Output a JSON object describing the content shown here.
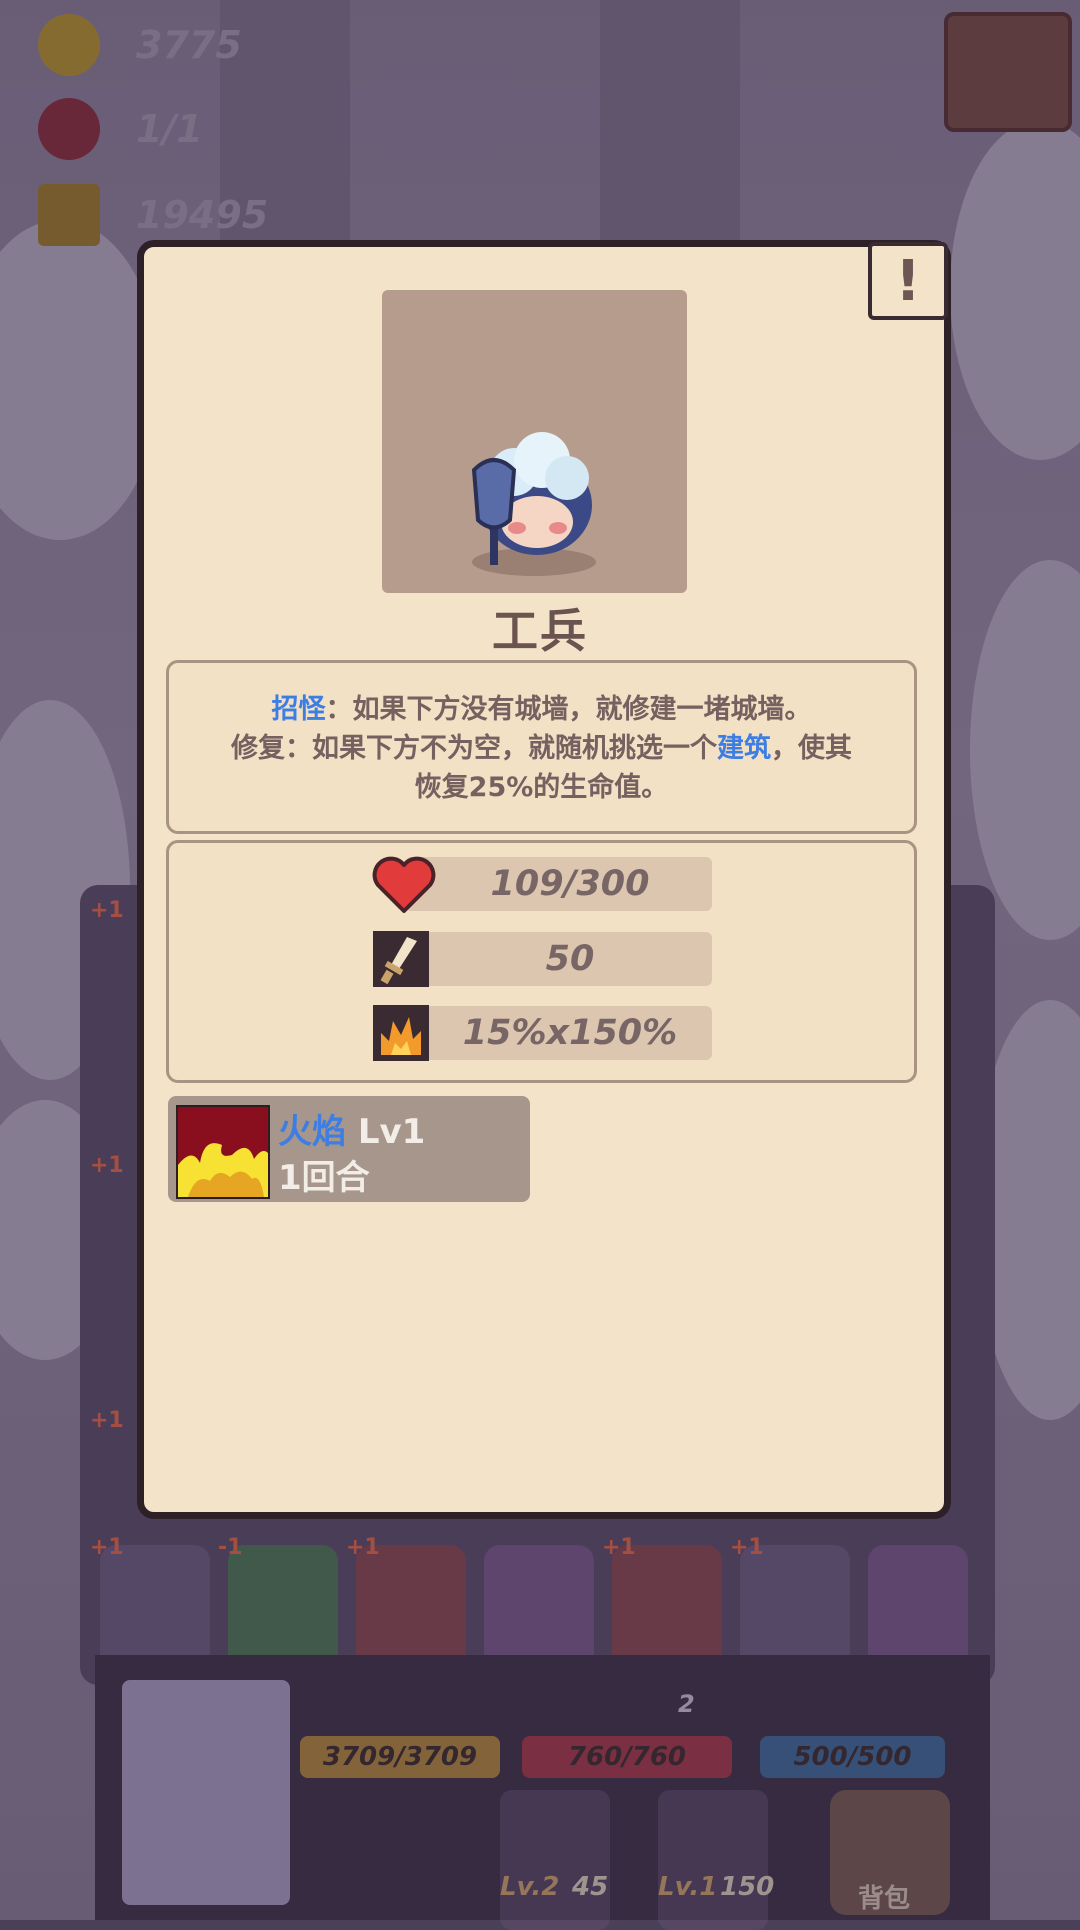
{
  "hud": {
    "gold": "3775",
    "monsters": "1/1",
    "crowns": "19495"
  },
  "modal": {
    "help_label": "!",
    "unit_name": "工兵",
    "ability1_keyword": "招怪",
    "ability1_text": "：如果下方没有城墙，就修建一堵城墙。",
    "ability2_prefix": "修复：如果下方不为空，就随机挑选一个",
    "ability2_keyword": "建筑",
    "ability2_suffix": "，使其",
    "ability2_line3": "恢复25%的生命值。",
    "stats": {
      "health": "109/300",
      "attack": "50",
      "crit": "15%x150%"
    },
    "buff": {
      "name": "火焰",
      "level": "Lv1",
      "duration": "1回合"
    }
  },
  "board": {
    "plus_labels": [
      "+1",
      "+1",
      "+1",
      "+1",
      "-1",
      "+1",
      "+1",
      "+1"
    ]
  },
  "player": {
    "shield": "3709/3709",
    "hp": "760/760",
    "mana": "500/500",
    "skill1_level": "Lv.2",
    "skill1_cost": "45",
    "skill2_level": "Lv.1",
    "skill2_cost": "150",
    "bag_label": "背包",
    "wall_count": "2"
  },
  "colors": {
    "keyword_blue": "#3e7ee3",
    "parchment": "#f3e3c8",
    "heart_red": "#e23b3b",
    "flame_yellow": "#f7e233"
  },
  "icons": [
    "gold-heart-coin-icon",
    "demon-face-icon",
    "crown-icon",
    "heart-icon",
    "sword-icon",
    "crit-flame-icon",
    "fire-buff-icon",
    "chest-icon"
  ]
}
